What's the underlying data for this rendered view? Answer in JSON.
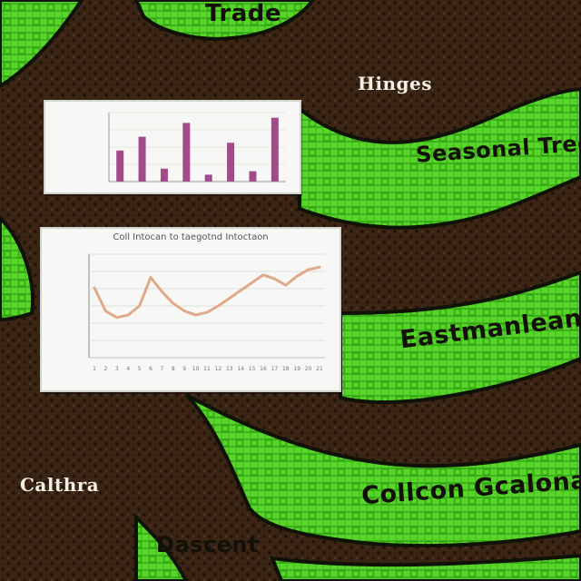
{
  "colors": {
    "soil": "#3a2414",
    "soil_dot": "#1e1108",
    "grass": "#57d62a",
    "grass_line": "#2f9a12",
    "outline": "#0f1206",
    "card_bg": "#f7f8f5",
    "bar": "#a24a8a",
    "line": "#e0a98a",
    "grid": "#d6d9d4"
  },
  "labels": {
    "top": "Trade",
    "upper_right": "Hinges",
    "band1": "Seasonal Tree",
    "band2": "Eastmanleanos",
    "left_bottom": "Calthra",
    "band3": "Collcon Gcalonat",
    "bottom": "Dascent"
  },
  "bar_card": {
    "title": "",
    "chart_data": {
      "type": "bar",
      "categories": [
        "",
        "",
        "",
        "",
        "",
        "",
        "",
        ""
      ],
      "values": [
        3.6,
        5.2,
        1.5,
        6.8,
        0.8,
        4.5,
        1.2,
        7.4
      ],
      "ylim": [
        0,
        8
      ]
    }
  },
  "line_card": {
    "title": "Coll Intocan to taegotnd Intoctaon",
    "chart_data": {
      "type": "line",
      "x": [
        "1",
        "2",
        "3",
        "4",
        "5",
        "6",
        "7",
        "8",
        "9",
        "10",
        "11",
        "12",
        "13",
        "14",
        "15",
        "16",
        "17",
        "18",
        "19",
        "20",
        "21"
      ],
      "y": [
        5.4,
        3.6,
        3.1,
        3.3,
        4.0,
        6.2,
        5.1,
        4.2,
        3.6,
        3.3,
        3.5,
        4.0,
        4.6,
        5.2,
        5.8,
        6.4,
        6.1,
        5.6,
        6.3,
        6.8,
        7.0
      ],
      "ylim": [
        0,
        8
      ]
    }
  }
}
